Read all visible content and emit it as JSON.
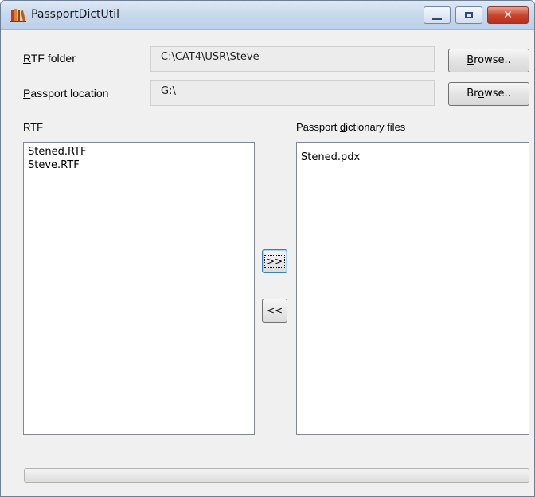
{
  "window": {
    "title": "PassportDictUtil",
    "close_glyph": "✕"
  },
  "rtf_folder": {
    "label_prefix": "",
    "label_access": "R",
    "label_rest": "TF folder",
    "value": "C:\\CAT4\\USR\\Steve",
    "browse_prefix": "",
    "browse_access": "B",
    "browse_rest": "rowse.."
  },
  "passport_location": {
    "label_prefix": "",
    "label_access": "P",
    "label_rest": "assport location",
    "value": "G:\\",
    "browse_prefix": "Br",
    "browse_access": "o",
    "browse_rest": "wse.."
  },
  "rtf_list": {
    "header": "RTF",
    "items": [
      "Stened.RTF",
      "Steve.RTF"
    ]
  },
  "passport_list": {
    "header_prefix": "Passport ",
    "header_access": "d",
    "header_rest": "ictionary files",
    "items": [
      "Stened.pdx"
    ]
  },
  "transfer": {
    "to_passport_label": ">>",
    "to_rtf_label": "<<"
  },
  "progress": {
    "value": 0
  },
  "colors": {
    "progress_fill": "#37b24d",
    "title_bar": "#c9d9ed",
    "close_button": "#c9452d"
  }
}
